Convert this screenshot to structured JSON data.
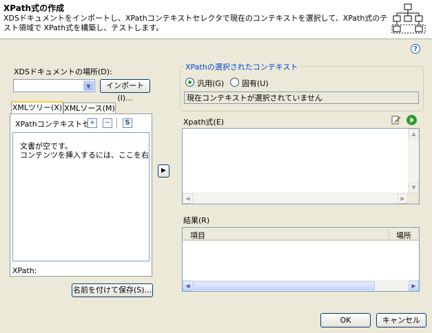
{
  "header": {
    "title": "XPath式の作成",
    "description": "XDSドキュメントをインポートし、XPathコンテキストセレクタで現在のコンテキストを選択して、XPath式のテスト領域で XPath式を構築し、テストします。",
    "logo_icon": "hierarchy-diagram-icon"
  },
  "help_icon": "?",
  "left": {
    "doc_location_label": "XDSドキュメントの場所(D):",
    "doc_location_value": "",
    "import_button": "インポート(I)...",
    "tabs": [
      {
        "label": "XMLツリー(X)",
        "active": true
      },
      {
        "label": "XMLソース(M)",
        "active": false
      }
    ],
    "toolbar_label": "XPathコンテキストセ",
    "tree_message_line1": "文書が空です。",
    "tree_message_line2": "コンテンツを挿入するには、ここを右マウス",
    "xpath_footer": "XPath:",
    "save_as_button": "名前を付けて保存(S)..."
  },
  "transfer_button": "▶",
  "context": {
    "group_title": "XPathの選択されたコンテキスト",
    "radio_generic": "汎用(G)",
    "radio_specific": "固有(U)",
    "selected": "generic",
    "status_text": "現在コンテキストが選択されていません"
  },
  "xpath": {
    "label": "Xpath式(E)",
    "value": ""
  },
  "results": {
    "label": "結果(R)",
    "columns": [
      "項目",
      "場所"
    ],
    "rows": []
  },
  "footer": {
    "ok_button": "OK",
    "cancel_button": "キャンセル"
  }
}
